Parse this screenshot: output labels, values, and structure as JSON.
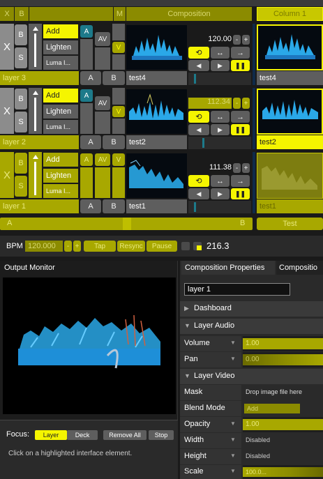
{
  "header": {
    "x_label": "X",
    "b_label": "B",
    "m_label": "M",
    "composition_label": "Composition",
    "column_label": "Column 1"
  },
  "layers": [
    {
      "name": "layer 3",
      "x": "X",
      "b": "B",
      "s": "S",
      "blend_modes": [
        "Add",
        "Lighten",
        "Luma I..."
      ],
      "a": "A",
      "av": "AV",
      "v": "V",
      "ab_a": "A",
      "ab_b": "B",
      "clip_name": "test4",
      "speed": "120.00",
      "minus": "-",
      "plus": "+",
      "column_clip": "test4"
    },
    {
      "name": "layer 2",
      "x": "X",
      "b": "B",
      "s": "S",
      "blend_modes": [
        "Add",
        "Lighten",
        "Luma I..."
      ],
      "a": "A",
      "av": "AV",
      "v": "V",
      "ab_a": "A",
      "ab_b": "B",
      "clip_name": "test2",
      "speed": "112.34",
      "minus": "-",
      "plus": "+",
      "column_clip": "test2"
    },
    {
      "name": "layer 1",
      "x": "X",
      "b": "B",
      "s": "S",
      "blend_modes": [
        "Add",
        "Lighten",
        "Luma I..."
      ],
      "a": "A",
      "av": "AV",
      "v": "V",
      "ab_a": "A",
      "ab_b": "B",
      "clip_name": "test1",
      "speed": "111.38",
      "minus": "-",
      "plus": "+",
      "column_clip": "test1"
    }
  ],
  "crossfader": {
    "a": "A",
    "b": "B",
    "test": "Test"
  },
  "bpm": {
    "label": "BPM",
    "value": "120.000",
    "minus": "-",
    "plus": "+",
    "tap": "Tap",
    "resync": "Resync",
    "pause": "Pause",
    "readout": "216.3"
  },
  "output_monitor": {
    "title": "Output Monitor"
  },
  "focus": {
    "label": "Focus:",
    "layer": "Layer",
    "deck": "Deck",
    "remove_all": "Remove All",
    "stop": "Stop",
    "hint": "Click on a highlighted interface element."
  },
  "properties": {
    "tabs": [
      "Composition Properties",
      "Compositio"
    ],
    "layer_name": "layer 1",
    "dashboard": "Dashboard",
    "layer_audio": "Layer Audio",
    "volume_label": "Volume",
    "volume_value": "1.00",
    "pan_label": "Pan",
    "pan_value": "0.00",
    "layer_video": "Layer Video",
    "mask_label": "Mask",
    "mask_value": "Drop image file here",
    "blend_label": "Blend Mode",
    "blend_value": "Add",
    "opacity_label": "Opacity",
    "opacity_value": "1.00",
    "width_label": "Width",
    "width_value": "Disabled",
    "height_label": "Height",
    "height_value": "Disabled",
    "scale_label": "Scale",
    "scale_value": "100.0..."
  },
  "colors": {
    "accent_yellow": "#f5f500",
    "olive": "#a8a800",
    "teal": "#1d7a8a",
    "clip_blue": "#2aa8e8"
  }
}
